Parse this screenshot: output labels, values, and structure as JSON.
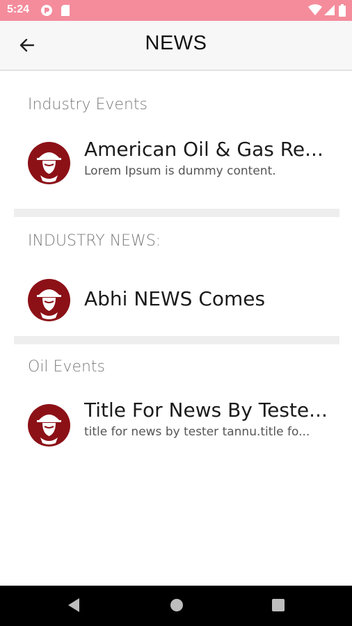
{
  "status_bar": {
    "time": "5:24",
    "icons": [
      "app-notification-icon",
      "sd-card-icon",
      "wifi-icon",
      "signal-icon",
      "battery-icon"
    ],
    "background": "#f48c9c"
  },
  "app_bar": {
    "title": "NEWS",
    "back_icon": "arrow-left-icon"
  },
  "sections": [
    {
      "title": "Industry Events",
      "item": {
        "title": "American Oil & Gas Re...",
        "subtitle": "Lorem Ipsum is dummy content.",
        "icon": "oil-worker-helmet-icon"
      }
    },
    {
      "title": "INDUSTRY NEWS:",
      "item": {
        "title": "Abhi NEWS Comes",
        "subtitle": "",
        "icon": "oil-worker-helmet-icon"
      }
    },
    {
      "title": "Oil Events",
      "item": {
        "title": "Title For News By Teste...",
        "subtitle": "title for news by tester tannu.title fo...",
        "icon": "oil-worker-helmet-icon"
      }
    }
  ],
  "nav_bar": {
    "buttons": [
      "back-triangle-icon",
      "home-circle-icon",
      "recents-square-icon"
    ]
  },
  "colors": {
    "accent": "#8c1117",
    "divider": "#eeeeee"
  }
}
